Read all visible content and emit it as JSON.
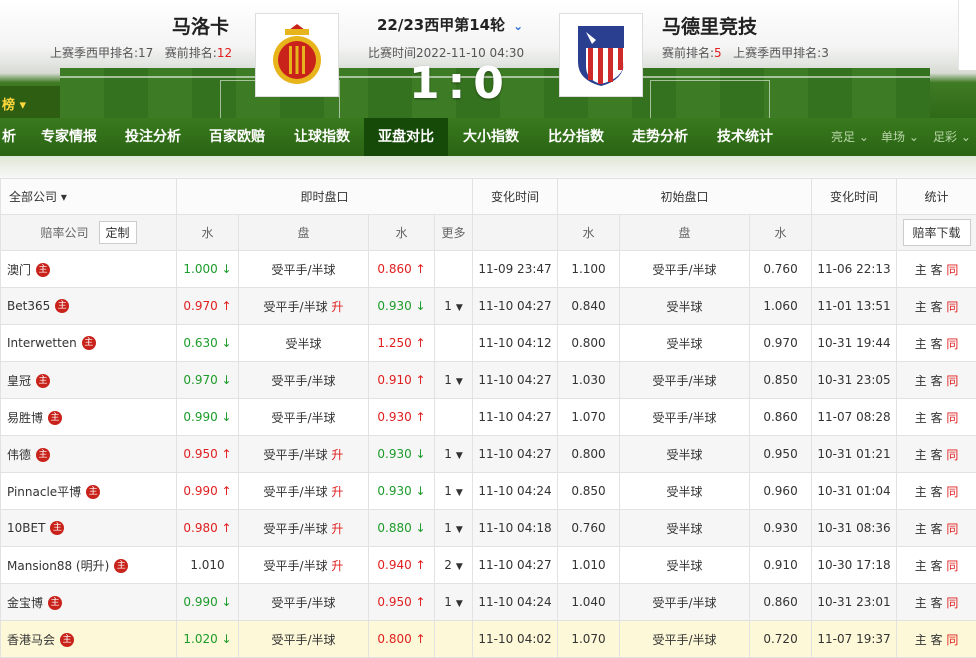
{
  "header": {
    "home": {
      "name": "马洛卡",
      "last_season_rank_label": "上赛季西甲排名:",
      "last_season_rank": "17",
      "pre_rank_label": "赛前排名:",
      "pre_rank": "12"
    },
    "away": {
      "name": "马德里竞技",
      "pre_rank_label": "赛前排名:",
      "pre_rank": "5",
      "last_season_rank_label": "上赛季西甲排名:",
      "last_season_rank": "3"
    },
    "round": "22/23西甲第14轮",
    "match_time": "比赛时间2022-11-10 04:30",
    "score_home": "1",
    "score_sep": ":",
    "score_away": "0",
    "side_tab": "榜"
  },
  "nav": {
    "items": [
      "析",
      "专家情报",
      "投注分析",
      "百家欧赔",
      "让球指数",
      "亚盘对比",
      "大小指数",
      "比分指数",
      "走势分析",
      "技术统计"
    ],
    "active_index": 5,
    "subs": [
      "亮足",
      "单场",
      "足彩"
    ]
  },
  "table": {
    "header1": {
      "all_companies": "全部公司",
      "live": "即时盘口",
      "change_time": "变化时间",
      "initial": "初始盘口",
      "change_time2": "变化时间",
      "stats": "统计"
    },
    "header2": {
      "company": "赔率公司",
      "customize": "定制",
      "water": "水",
      "line": "盘",
      "water2": "水",
      "more": "更多",
      "init_water": "水",
      "init_line": "盘",
      "init_water2": "水",
      "download": "赔率下载"
    },
    "zhu_glyph": "主",
    "rows": [
      {
        "company": "澳门",
        "w1": "1.000",
        "w1_dir": "down",
        "line": "受平手/半球",
        "line_up": "",
        "w2": "0.860",
        "w2_dir": "up",
        "more": "",
        "time": "11-09 23:47",
        "iw1": "1.100",
        "iline": "受平手/半球",
        "iw2": "0.760",
        "itime": "11-06 22:13",
        "s1": "主",
        "s2": "客",
        "s3": "同"
      },
      {
        "company": "Bet365",
        "w1": "0.970",
        "w1_dir": "up",
        "line": "受平手/半球",
        "line_up": "升",
        "w2": "0.930",
        "w2_dir": "down",
        "more": "1",
        "time": "11-10 04:27",
        "iw1": "0.840",
        "iline": "受半球",
        "iw2": "1.060",
        "itime": "11-01 13:51",
        "s1": "主",
        "s2": "客",
        "s3": "同"
      },
      {
        "company": "Interwetten",
        "w1": "0.630",
        "w1_dir": "down",
        "line": "受半球",
        "line_up": "",
        "w2": "1.250",
        "w2_dir": "up",
        "more": "",
        "time": "11-10 04:12",
        "iw1": "0.800",
        "iline": "受半球",
        "iw2": "0.970",
        "itime": "10-31 19:44",
        "s1": "主",
        "s2": "客",
        "s3": "同"
      },
      {
        "company": "皇冠",
        "w1": "0.970",
        "w1_dir": "down",
        "line": "受平手/半球",
        "line_up": "",
        "w2": "0.910",
        "w2_dir": "up",
        "more": "1",
        "time": "11-10 04:27",
        "iw1": "1.030",
        "iline": "受平手/半球",
        "iw2": "0.850",
        "itime": "10-31 23:05",
        "s1": "主",
        "s2": "客",
        "s3": "同"
      },
      {
        "company": "易胜博",
        "w1": "0.990",
        "w1_dir": "down",
        "line": "受平手/半球",
        "line_up": "",
        "w2": "0.930",
        "w2_dir": "up",
        "more": "",
        "time": "11-10 04:27",
        "iw1": "1.070",
        "iline": "受平手/半球",
        "iw2": "0.860",
        "itime": "11-07 08:28",
        "s1": "主",
        "s2": "客",
        "s3": "同"
      },
      {
        "company": "伟德",
        "w1": "0.950",
        "w1_dir": "up",
        "line": "受平手/半球",
        "line_up": "升",
        "w2": "0.930",
        "w2_dir": "down",
        "more": "1",
        "time": "11-10 04:27",
        "iw1": "0.800",
        "iline": "受半球",
        "iw2": "0.950",
        "itime": "10-31 01:21",
        "s1": "主",
        "s2": "客",
        "s3": "同"
      },
      {
        "company": "Pinnacle平博",
        "w1": "0.990",
        "w1_dir": "up",
        "line": "受平手/半球",
        "line_up": "升",
        "w2": "0.930",
        "w2_dir": "down",
        "more": "1",
        "time": "11-10 04:24",
        "iw1": "0.850",
        "iline": "受半球",
        "iw2": "0.960",
        "itime": "10-31 01:04",
        "s1": "主",
        "s2": "客",
        "s3": "同"
      },
      {
        "company": "10BET",
        "w1": "0.980",
        "w1_dir": "up",
        "line": "受平手/半球",
        "line_up": "升",
        "w2": "0.880",
        "w2_dir": "down",
        "more": "1",
        "time": "11-10 04:18",
        "iw1": "0.760",
        "iline": "受半球",
        "iw2": "0.930",
        "itime": "10-31 08:36",
        "s1": "主",
        "s2": "客",
        "s3": "同"
      },
      {
        "company": "Mansion88 (明升)",
        "w1": "1.010",
        "w1_dir": "",
        "line": "受平手/半球",
        "line_up": "升",
        "w2": "0.940",
        "w2_dir": "up",
        "more": "2",
        "time": "11-10 04:27",
        "iw1": "1.010",
        "iline": "受半球",
        "iw2": "0.910",
        "itime": "10-30 17:18",
        "s1": "主",
        "s2": "客",
        "s3": "同"
      },
      {
        "company": "金宝博",
        "w1": "0.990",
        "w1_dir": "down",
        "line": "受平手/半球",
        "line_up": "",
        "w2": "0.950",
        "w2_dir": "up",
        "more": "1",
        "time": "11-10 04:24",
        "iw1": "1.040",
        "iline": "受平手/半球",
        "iw2": "0.860",
        "itime": "10-31 23:01",
        "s1": "主",
        "s2": "客",
        "s3": "同"
      },
      {
        "company": "香港马会",
        "w1": "1.020",
        "w1_dir": "down",
        "line": "受平手/半球",
        "line_up": "",
        "w2": "0.800",
        "w2_dir": "up",
        "more": "",
        "time": "11-10 04:02",
        "iw1": "1.070",
        "iline": "受平手/半球",
        "iw2": "0.720",
        "itime": "11-07 19:37",
        "s1": "主",
        "s2": "客",
        "s3": "同"
      }
    ]
  },
  "colors": {
    "up": "#e02020",
    "down": "#1d9b2a",
    "nav_bg": "#2f6a18",
    "highlight_row": "#fdf8d8"
  }
}
